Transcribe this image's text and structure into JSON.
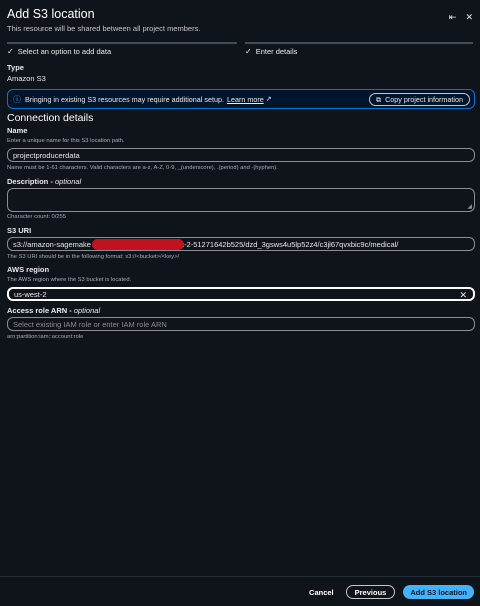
{
  "header": {
    "title": "Add S3 location",
    "subtitle": "This resource will be shared between all project members.",
    "collapse_icon": "⇤",
    "close_icon": "✕"
  },
  "steps": [
    {
      "label": "Select an option to add data",
      "icon": "✓"
    },
    {
      "label": "Enter details",
      "icon": "✓"
    }
  ],
  "type": {
    "label": "Type",
    "value": "Amazon S3"
  },
  "alert": {
    "icon": "ⓘ",
    "text": "Bringing in existing S3 resources may require additional setup.",
    "link": "Learn more",
    "external_icon": "↗",
    "copy_icon": "⧉",
    "copy_button": "Copy project information"
  },
  "connection": {
    "title": "Connection details",
    "name": {
      "label": "Name",
      "description": "Enter a unique name for this S3 location path.",
      "value": "projectproducerdata",
      "constraint": "Name must be 1-61 characters. Valid characters are a-z, A-Z, 0-9, _(underscore), .(period) and -(hyphen)."
    },
    "description": {
      "label": "Description",
      "optional": "optional",
      "separator": " - ",
      "resize_icon": "◢",
      "counter": "Character count: 0/255"
    },
    "s3_uri": {
      "label": "S3 URI",
      "value_start": "s3://amazon-sagemake",
      "value_end": "t-2-51271642b525/dzd_3gsws4u5lp52z4/c3jl67qvxbic9c/medical/",
      "hint": "The S3 URI should be in the following format: s3://<bucket>/<key>/"
    },
    "region": {
      "label": "AWS region",
      "description": "The AWS region where the S3 bucket is located.",
      "value": "us-west-2",
      "clear_icon": "✕"
    },
    "role": {
      "label": "Access role ARN",
      "optional": "optional",
      "separator": " - ",
      "placeholder": "Select existing IAM role or enter IAM role ARN",
      "hint": "arn:partition:iam::account:role"
    }
  },
  "footer": {
    "cancel": "Cancel",
    "previous": "Previous",
    "submit": "Add S3 location"
  }
}
